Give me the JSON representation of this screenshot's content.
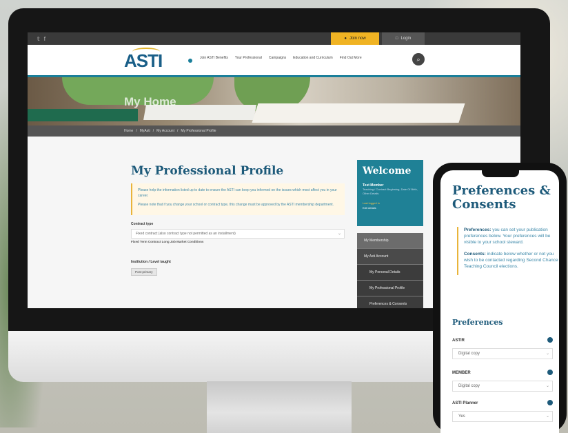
{
  "site": {
    "topbar": {
      "social": [
        "𝕥",
        "f"
      ],
      "join_label": "Join now",
      "login_label": "Login"
    },
    "logo": "ASTI",
    "nav": [
      "Join ASTI Benefits",
      "Your Professional",
      "Campaigns",
      "Education and Curriculum",
      "Find Out More"
    ],
    "hero_title": "My Home",
    "breadcrumb": [
      "Home",
      "/",
      "MyAsti",
      "/",
      "My Account",
      "/",
      "My Professional Profile"
    ]
  },
  "profile": {
    "title": "My Professional Profile",
    "notice": [
      "Please help the information listed up to date to ensure the ASTI can keep you informed on the issues which most affect you in your career.",
      "Please note that if you change your school or contract type, this change must be approved by the ASTI membership department."
    ],
    "field1_label": "Contract type",
    "field1_value": "Fixed contract (also contract type not permitted as an installment)",
    "field1_hint": "Fixed Term Contract Long Job Market Conditions",
    "field2_label": "Institution / Level taught",
    "field2_pill": "Post-primary"
  },
  "welcome": {
    "title": "Welcome",
    "name": "Test Member",
    "sub": "Teaching / Contract Beginning, Date Of Birth, Other Details",
    "link1": "Last logged in",
    "link2": "Edit details"
  },
  "sidebar": {
    "items": [
      "My Membership",
      "My Asti Account",
      "My Personal Details",
      "My Professional Profile",
      "Preferences & Consents"
    ]
  },
  "phone": {
    "title": "Preferences & Consents",
    "pref_label": "Preferences:",
    "pref_text": " you can set your publication preferences below. Your preferences will be visible to your school steward.",
    "cons_label": "Consents:",
    "cons_text": " indicate below whether or not you wish to be contacted regarding Second Chance Teaching Council elections.",
    "section": "Preferences",
    "rows": [
      {
        "label": "ASTIR",
        "value": "Digital copy"
      },
      {
        "label": "MEMBER",
        "value": "Digital copy"
      },
      {
        "label": "ASTI Planner",
        "value": "Yes"
      }
    ]
  }
}
